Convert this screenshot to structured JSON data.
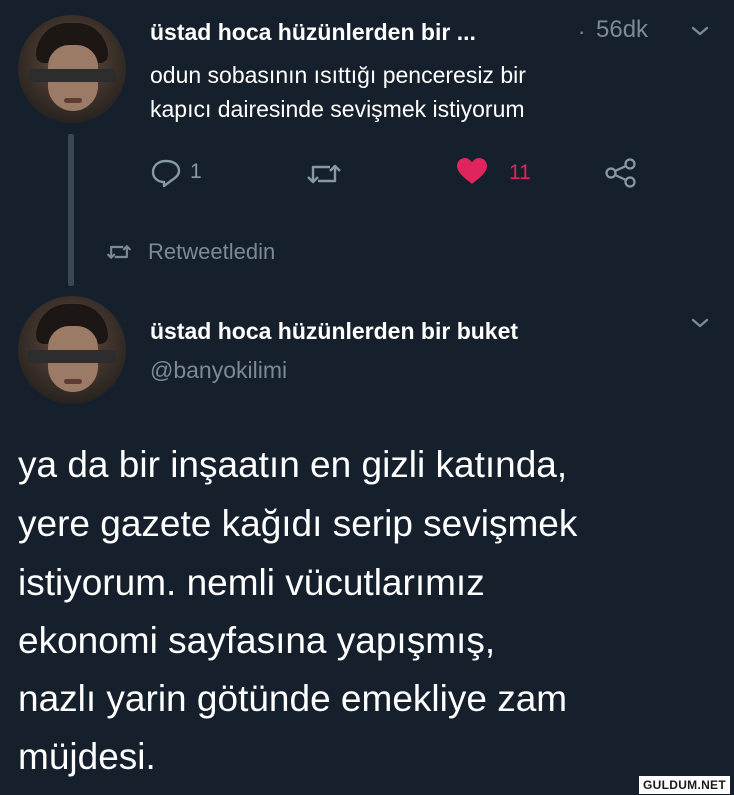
{
  "tweet1": {
    "author": "üstad hoca hüzünlerden bir ...",
    "dot": "·",
    "time": "56dk",
    "text_line1": "odun sobasının ısıttığı penceresiz bir",
    "text_line2": "kapıcı dairesinde sevişmek istiyorum",
    "reply_count": "1",
    "like_count": "11",
    "liked": true
  },
  "retweet_notice": "Retweetledin",
  "tweet2": {
    "author": "üstad hoca hüzünlerden bir buket",
    "handle": "@banyokilimi",
    "lines": [
      "ya da bir inşaatın en gizli katında,",
      "yere gazete kağıdı serip sevişmek",
      "istiyorum. nemli vücutlarımız",
      "ekonomi sayfasına yapışmış,",
      "nazlı yarin götünde emekliye zam",
      "müjdesi."
    ]
  },
  "watermark": "GULDUM.NET",
  "colors": {
    "background": "#16202c",
    "muted": "#8899a6",
    "like": "#e0245e"
  },
  "icons": [
    "chevron-down-icon",
    "reply-icon",
    "retweet-icon",
    "heart-icon",
    "share-icon"
  ]
}
